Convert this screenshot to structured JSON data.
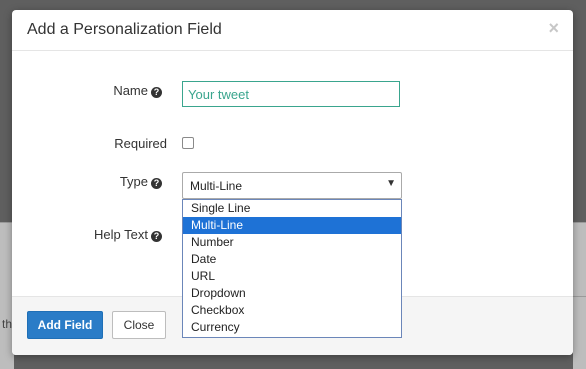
{
  "background": {
    "fragment_text": "th"
  },
  "modal": {
    "title": "Add a Personalization Field",
    "close_glyph": "×"
  },
  "form": {
    "name_label": "Name",
    "name_value": "Your tweet",
    "required_label": "Required",
    "required_checked": false,
    "type_label": "Type",
    "type_selected": "Multi-Line",
    "help_text_label": "Help Text",
    "help_glyph": "?",
    "type_options": [
      "Single Line",
      "Multi-Line",
      "Number",
      "Date",
      "URL",
      "Dropdown",
      "Checkbox",
      "Currency"
    ]
  },
  "footer": {
    "add_label": "Add Field",
    "close_label": "Close"
  },
  "colors": {
    "primary": "#2a7cc7",
    "accent_green": "#3aa58e",
    "selected_option": "#1e72d6"
  }
}
